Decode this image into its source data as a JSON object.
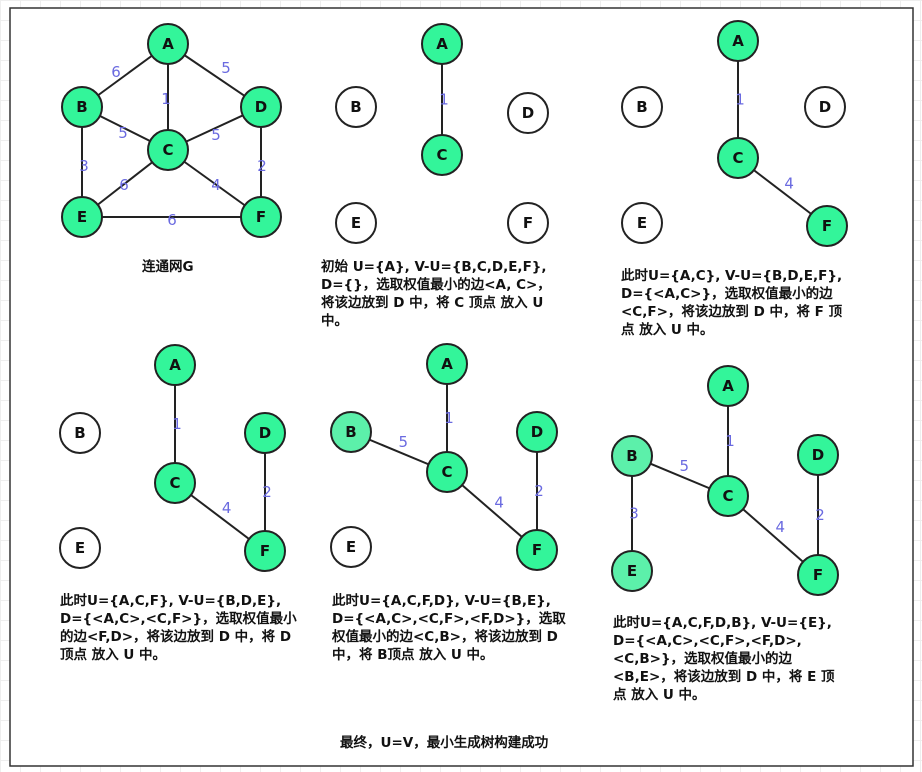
{
  "colors": {
    "selected": "#33f59a",
    "reached": "#5cf0aa",
    "unselected": "#ffffff",
    "weight_text": "#6a6ae0"
  },
  "panels": [
    {
      "id": "G",
      "caption": "连通网G",
      "nodes": [
        {
          "id": "A",
          "state": "selected"
        },
        {
          "id": "B",
          "state": "selected"
        },
        {
          "id": "C",
          "state": "selected"
        },
        {
          "id": "D",
          "state": "selected"
        },
        {
          "id": "E",
          "state": "selected"
        },
        {
          "id": "F",
          "state": "selected"
        }
      ],
      "edges": [
        {
          "from": "A",
          "to": "B",
          "weight": "6"
        },
        {
          "from": "A",
          "to": "C",
          "weight": "1"
        },
        {
          "from": "A",
          "to": "D",
          "weight": "5"
        },
        {
          "from": "B",
          "to": "C",
          "weight": "5"
        },
        {
          "from": "C",
          "to": "D",
          "weight": "5"
        },
        {
          "from": "B",
          "to": "E",
          "weight": "3"
        },
        {
          "from": "D",
          "to": "F",
          "weight": "2"
        },
        {
          "from": "C",
          "to": "E",
          "weight": "6"
        },
        {
          "from": "C",
          "to": "F",
          "weight": "4"
        },
        {
          "from": "E",
          "to": "F",
          "weight": "6"
        }
      ]
    },
    {
      "id": "step1",
      "caption": "初始 U={A}, V-U={B,C,D,E,F}, D={}，选取权值最小的边<A, C>，将该边放到 D 中，将 C 顶点 放入 U 中。",
      "nodes": [
        {
          "id": "A",
          "state": "selected"
        },
        {
          "id": "C",
          "state": "selected"
        },
        {
          "id": "B",
          "state": "unselected"
        },
        {
          "id": "D",
          "state": "unselected"
        },
        {
          "id": "E",
          "state": "unselected"
        },
        {
          "id": "F",
          "state": "unselected"
        }
      ],
      "edges": [
        {
          "from": "A",
          "to": "C",
          "weight": "1"
        }
      ]
    },
    {
      "id": "step2",
      "caption": "此时U={A,C}, V-U={B,D,E,F}, D={<A,C>}，选取权值最小的边<C,F>，将该边放到 D 中，将 F 顶点 放入 U 中。",
      "nodes": [
        {
          "id": "A",
          "state": "selected"
        },
        {
          "id": "C",
          "state": "selected"
        },
        {
          "id": "F",
          "state": "selected"
        },
        {
          "id": "B",
          "state": "unselected"
        },
        {
          "id": "D",
          "state": "unselected"
        },
        {
          "id": "E",
          "state": "unselected"
        }
      ],
      "edges": [
        {
          "from": "A",
          "to": "C",
          "weight": "1"
        },
        {
          "from": "C",
          "to": "F",
          "weight": "4"
        }
      ]
    },
    {
      "id": "step3",
      "caption": "此时U={A,C,F}, V-U={B,D,E}, D={<A,C>,<C,F>}，选取权值最小的边<F,D>，将该边放到 D 中，将 D顶点 放入 U 中。",
      "nodes": [
        {
          "id": "A",
          "state": "selected"
        },
        {
          "id": "C",
          "state": "selected"
        },
        {
          "id": "F",
          "state": "selected"
        },
        {
          "id": "D",
          "state": "selected"
        },
        {
          "id": "B",
          "state": "unselected"
        },
        {
          "id": "E",
          "state": "unselected"
        }
      ],
      "edges": [
        {
          "from": "A",
          "to": "C",
          "weight": "1"
        },
        {
          "from": "C",
          "to": "F",
          "weight": "4"
        },
        {
          "from": "D",
          "to": "F",
          "weight": "2"
        }
      ]
    },
    {
      "id": "step4",
      "caption": "此时U={A,C,F,D}, V-U={B,E}, D={<A,C>,<C,F>,<F,D>}，选取权值最小的边<C,B>，将该边放到 D 中，将 B顶点 放入 U 中。",
      "nodes": [
        {
          "id": "A",
          "state": "selected"
        },
        {
          "id": "C",
          "state": "selected"
        },
        {
          "id": "F",
          "state": "selected"
        },
        {
          "id": "D",
          "state": "selected"
        },
        {
          "id": "B",
          "state": "reached"
        },
        {
          "id": "E",
          "state": "unselected"
        }
      ],
      "edges": [
        {
          "from": "A",
          "to": "C",
          "weight": "1"
        },
        {
          "from": "C",
          "to": "F",
          "weight": "4"
        },
        {
          "from": "D",
          "to": "F",
          "weight": "2"
        },
        {
          "from": "B",
          "to": "C",
          "weight": "5"
        }
      ]
    },
    {
      "id": "step5",
      "caption": "此时U={A,C,F,D,B}, V-U={E}, D={<A,C>,<C,F>,<F,D>,<C,B>}，选取权值最小的边<B,E>，将该边放到 D 中，将 E 顶点 放入 U 中。",
      "nodes": [
        {
          "id": "A",
          "state": "selected"
        },
        {
          "id": "C",
          "state": "selected"
        },
        {
          "id": "F",
          "state": "selected"
        },
        {
          "id": "D",
          "state": "selected"
        },
        {
          "id": "B",
          "state": "reached"
        },
        {
          "id": "E",
          "state": "reached"
        }
      ],
      "edges": [
        {
          "from": "A",
          "to": "C",
          "weight": "1"
        },
        {
          "from": "C",
          "to": "F",
          "weight": "4"
        },
        {
          "from": "D",
          "to": "F",
          "weight": "2"
        },
        {
          "from": "B",
          "to": "C",
          "weight": "5"
        },
        {
          "from": "B",
          "to": "E",
          "weight": "3"
        }
      ]
    }
  ],
  "final_caption": "最终，U=V，最小生成树构建成功"
}
